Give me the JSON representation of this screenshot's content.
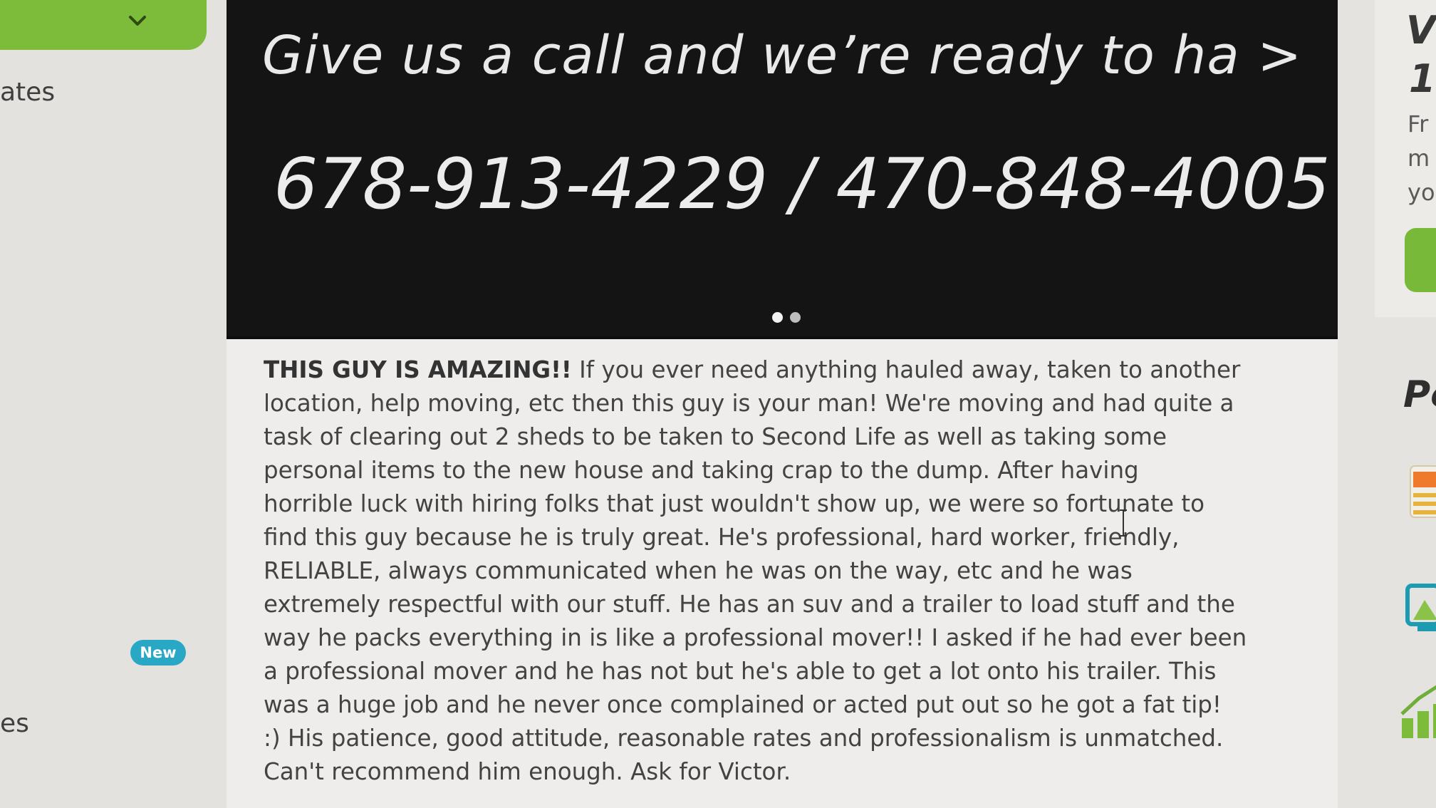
{
  "left_sidebar": {
    "partial_label_top": "ates",
    "partial_label_bottom": "es",
    "new_badge": "New"
  },
  "hero": {
    "title": "Give us a call and we’re ready to ha >",
    "phones": "678-913-4229 / 470-848-4005",
    "carousel": {
      "slides": 2,
      "active_slide": 1
    }
  },
  "review": {
    "lead": "THIS GUY IS AMAZING!!",
    "body": " If you ever need anything hauled away, taken to another\nlocation, help moving, etc then this guy is your man!  We're moving and had quite a\ntask of clearing out 2 sheds to be taken to Second Life as well as taking some\npersonal items to the new house and taking crap to the dump.  After having\nhorrible luck with hiring folks that just wouldn't show up, we were so fortunate to\nfind this guy because he is truly great.  He's professional, hard worker, friendly,\nRELIABLE, always communicated when he was on the way, etc and he was\nextremely respectful with our stuff.  He has an suv and a trailer to load stuff and the\nway he packs everything in is like a professional mover!!  I asked if he had ever been\na professional mover and he has not but he's able to get a lot onto his trailer.  This\nwas a huge job and he never once complained or acted put out so he got a fat tip!\n:)    His patience, good attitude, reasonable rates and professionalism is unmatched.\nCan't recommend him enough.  Ask for Victor."
  },
  "right_sidebar": {
    "partial_heading_1": "V",
    "partial_heading_2": "1",
    "partial_line_1": "Fr",
    "partial_line_2": "m",
    "partial_line_3": "yo",
    "partial_section_heading": "Pc"
  },
  "colors": {
    "accent_green": "#7dbb3b",
    "badge_blue": "#29a8c6",
    "hero_background": "#141414"
  },
  "icons": [
    "chevron-down-icon",
    "text-cursor-icon",
    "list-icon",
    "image-icon",
    "chart-icon"
  ]
}
